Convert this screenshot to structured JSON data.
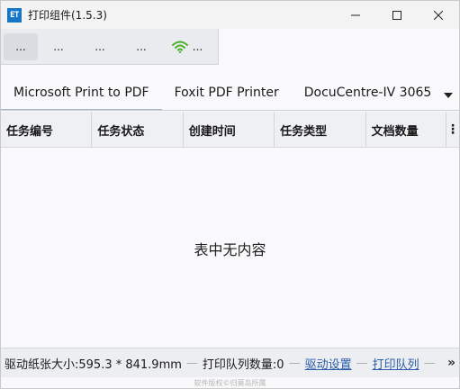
{
  "window": {
    "title": "打印组件(1.5.3)",
    "app_icon_text": "ET",
    "controls": [
      "minimize-icon",
      "maximize-icon",
      "close-icon"
    ]
  },
  "toolbar": {
    "buttons": [
      {
        "label": "...",
        "icon": null
      },
      {
        "label": "...",
        "icon": null
      },
      {
        "label": "...",
        "icon": null
      },
      {
        "label": "...",
        "icon": null
      },
      {
        "label": "...",
        "icon": "wifi-icon",
        "icon_color": "#4caf2a"
      }
    ]
  },
  "tabs": {
    "items": [
      {
        "label": "Microsoft Print to PDF",
        "active": true
      },
      {
        "label": "Foxit PDF Printer",
        "active": false
      },
      {
        "label": "DocuCentre-IV 3065",
        "active": false
      }
    ],
    "dropdown_icon": "triangle-down-icon"
  },
  "table": {
    "columns": [
      "任务编号",
      "任务状态",
      "创建时间",
      "任务类型",
      "文档数量"
    ],
    "more_icon": "vertical-ellipsis-icon",
    "rows": [],
    "empty_text": "表中无内容"
  },
  "status": {
    "paper_size": "驱动纸张大小:595.3 * 841.9mm",
    "queue_count": "打印队列数量:0",
    "driver_settings": "驱动设置",
    "print_queue": "打印队列",
    "more_icon": "double-chevron-right-icon"
  },
  "footer": {
    "copyright": "软件版权©归莫岛所属"
  },
  "colors": {
    "accent": "#1677c9",
    "wifi": "#4caf2a",
    "link": "#2a5ca8"
  }
}
